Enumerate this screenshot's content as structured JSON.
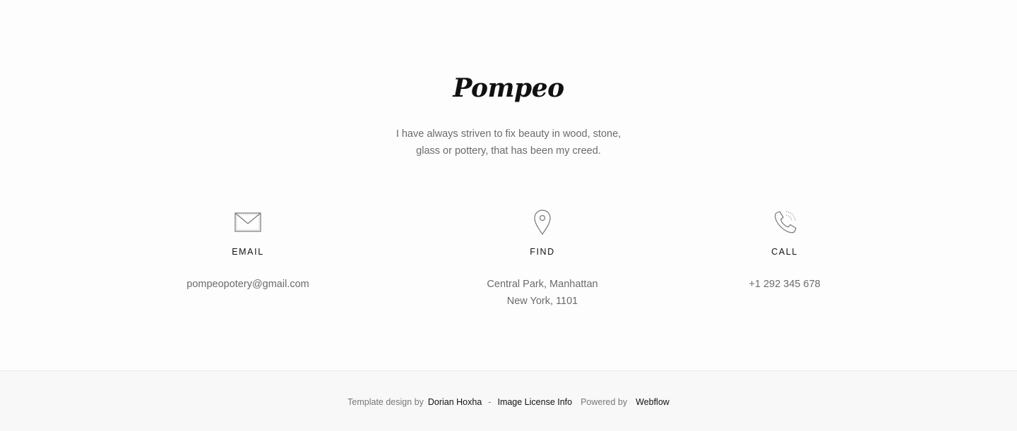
{
  "brand": {
    "name": "Pompeo"
  },
  "tagline": {
    "line1": "I have always striven to fix beauty in wood, stone,",
    "line2": "glass or pottery, that has been my creed."
  },
  "contact": {
    "email": {
      "icon": "envelope-icon",
      "label": "EMAIL",
      "value": "pompeopotery@gmail.com"
    },
    "find": {
      "icon": "location-pin-icon",
      "label": "FIND",
      "line1": "Central Park, Manhattan",
      "line2": "New York, 1101"
    },
    "call": {
      "icon": "phone-icon",
      "label": "CALL",
      "value": "+1 292 345 678"
    }
  },
  "footer": {
    "template_prefix": "Template design by",
    "designer_link": "Dorian Hoxha",
    "separator": "-",
    "license_link": "Image License Info",
    "powered_prefix": "Powered by",
    "platform_link": "Webflow"
  },
  "colors": {
    "background": "#fdfdfd",
    "footer_background": "#f8f8f8",
    "text_muted": "#6b6b6b",
    "text_dark": "#111111"
  }
}
